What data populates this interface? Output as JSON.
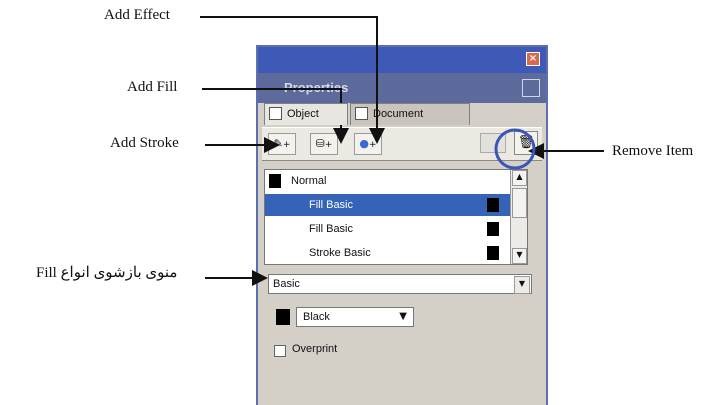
{
  "callouts": {
    "add_effect": "Add Effect",
    "add_fill": "Add Fill",
    "add_stroke": "Add Stroke",
    "remove_item": "Remove Item",
    "fill_menu": "منوی بازشوی انواع Fill"
  },
  "panel": {
    "title": "Properties",
    "tabs": [
      {
        "label": "Object",
        "active": true
      },
      {
        "label": "Document",
        "active": false
      }
    ],
    "toolbar": {
      "add_stroke_icon": "pen-icon",
      "add_fill_icon": "bucket-icon",
      "add_effect_icon": "effect-icon",
      "remove_icon": "trash-icon"
    },
    "list": [
      {
        "label": "Normal",
        "swatch": "#000000",
        "selected": false
      },
      {
        "label": "Fill Basic",
        "swatch": "#000000",
        "selected": true
      },
      {
        "label": "Fill Basic",
        "swatch": "#000000",
        "selected": false
      },
      {
        "label": "Stroke Basic",
        "swatch": "#000000",
        "selected": false
      }
    ],
    "fill_type": "Basic",
    "color": {
      "value": "Black",
      "swatch": "#000000"
    },
    "overprint": {
      "label": "Overprint",
      "checked": false
    }
  },
  "colors": {
    "accent": "#3563b7",
    "titlebar": "#3e5ab6",
    "highlight_circle": "#3a56b8"
  }
}
